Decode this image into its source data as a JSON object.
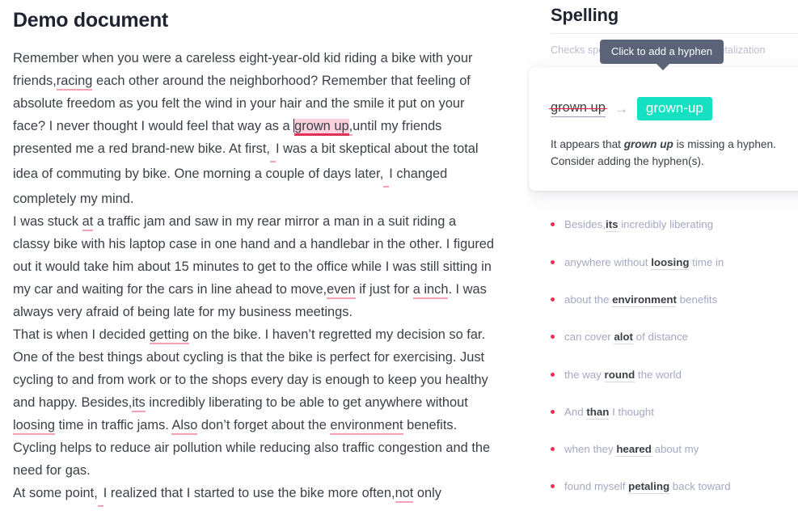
{
  "document": {
    "title": "Demo document",
    "paragraphs": [
      {
        "id": "p1",
        "runs": [
          {
            "t": "Remember when you were a careless eight-year-old kid riding a bike with your friends,",
            "s": "plain"
          },
          {
            "t": "racing",
            "s": "err"
          },
          {
            "t": " each other around the neighborhood? Remember that feeling of absolute freedom as you felt the wind in your hair and the smile it put on your face? I never thought I would feel that way as a ",
            "s": "plain"
          },
          {
            "t": "",
            "s": "caret"
          },
          {
            "t": "grown up",
            "s": "err-active"
          },
          {
            "t": ",",
            "s": "err"
          },
          {
            "t": "until my friends presented me a red brand-new bike. At first,",
            "s": "plain"
          },
          {
            "t": "",
            "s": "err-sm"
          },
          {
            "t": "I was a bit skeptical about the total idea of commuting by bike. One morning a couple of days later,",
            "s": "plain"
          },
          {
            "t": "",
            "s": "err-sm"
          },
          {
            "t": "I changed completely my mind.",
            "s": "plain"
          }
        ]
      },
      {
        "id": "p2",
        "runs": [
          {
            "t": "I was stuck ",
            "s": "plain"
          },
          {
            "t": "at",
            "s": "err"
          },
          {
            "t": " a traffic jam and saw in my rear mirror a man in a suit riding a classy bike with his laptop case in one hand and a handlebar in the other. I figured out it would take him about 15 minutes to get to the office while I was still sitting in my car and waiting for the cars in line ahead to move,",
            "s": "plain"
          },
          {
            "t": "even",
            "s": "err"
          },
          {
            "t": " if just for ",
            "s": "plain"
          },
          {
            "t": "a inch",
            "s": "err"
          },
          {
            "t": ". I was always very afraid of being late for my business meetings.",
            "s": "plain"
          }
        ]
      },
      {
        "id": "p3",
        "runs": [
          {
            "t": "That is when I decided ",
            "s": "plain"
          },
          {
            "t": "getting",
            "s": "err"
          },
          {
            "t": " on the bike. I haven’t regretted my decision so far. One of the best things about cycling is that the bike is perfect for exercising. Just cycling to and from work or to the shops every day is enough to keep you healthy and happy. Besides,",
            "s": "plain"
          },
          {
            "t": "its",
            "s": "err"
          },
          {
            "t": " incredibly liberating to be able to get anywhere without ",
            "s": "plain"
          },
          {
            "t": "loosing",
            "s": "err"
          },
          {
            "t": " time in traffic jams. ",
            "s": "plain"
          },
          {
            "t": "Also",
            "s": "err"
          },
          {
            "t": " don’t forget about the ",
            "s": "plain"
          },
          {
            "t": "environment",
            "s": "err"
          },
          {
            "t": " benefits. Cycling helps to reduce air pollution while reducing also traffic congestion and the need for gas.",
            "s": "plain"
          }
        ]
      },
      {
        "id": "p4",
        "runs": [
          {
            "t": "At some point,",
            "s": "plain"
          },
          {
            "t": "",
            "s": "err-sm"
          },
          {
            "t": "I realized that I started to use the bike more often,",
            "s": "plain"
          },
          {
            "t": "not",
            "s": "err"
          },
          {
            "t": " only",
            "s": "plain"
          }
        ]
      }
    ]
  },
  "sidebar": {
    "title": "Spelling",
    "subtitle": "Checks spelling, confused words, capitalization",
    "card": {
      "tooltip": "Click to add a hyphen",
      "original": "grown up",
      "arrow_glyph": "→",
      "suggestion": "grown-up",
      "explanation_prefix": "It appears that ",
      "explanation_term": "grown up",
      "explanation_suffix": " is missing a hyphen. Consider adding the hyphen(s)."
    },
    "issues": [
      {
        "before": "Besides,",
        "word": "its",
        "after": " incredibly liberating"
      },
      {
        "before": "anywhere without ",
        "word": "loosing",
        "after": " time in"
      },
      {
        "before": "about the ",
        "word": "environment",
        "after": " benefits"
      },
      {
        "before": "can cover ",
        "word": "alot",
        "after": " of distance"
      },
      {
        "before": "the way ",
        "word": "round",
        "after": " the world"
      },
      {
        "before": "And ",
        "word": "than",
        "after": " I thought"
      },
      {
        "before": "when they ",
        "word": "heared",
        "after": " about my"
      },
      {
        "before": "found myself ",
        "word": "petaling",
        "after": " back toward"
      }
    ]
  },
  "colors": {
    "error_underline": "#f5a3b4",
    "active_highlight": "#fbd2dc",
    "active_underline": "#e03055",
    "suggestion_chip": "#15e0c2",
    "tooltip_bg": "#5b6378",
    "bullet": "#f02d52",
    "text": "#3b4048",
    "muted": "#a3a9c2"
  }
}
